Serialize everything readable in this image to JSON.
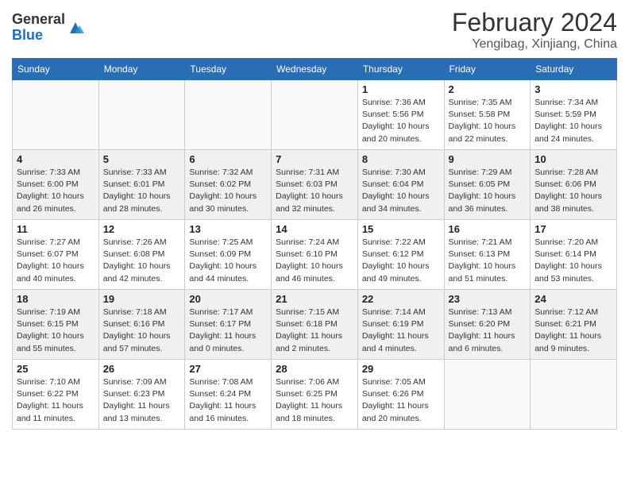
{
  "header": {
    "logo_general": "General",
    "logo_blue": "Blue",
    "month_year": "February 2024",
    "location": "Yengibag, Xinjiang, China"
  },
  "days_of_week": [
    "Sunday",
    "Monday",
    "Tuesday",
    "Wednesday",
    "Thursday",
    "Friday",
    "Saturday"
  ],
  "weeks": [
    [
      {
        "day": "",
        "info": ""
      },
      {
        "day": "",
        "info": ""
      },
      {
        "day": "",
        "info": ""
      },
      {
        "day": "",
        "info": ""
      },
      {
        "day": "1",
        "info": "Sunrise: 7:36 AM\nSunset: 5:56 PM\nDaylight: 10 hours and 20 minutes."
      },
      {
        "day": "2",
        "info": "Sunrise: 7:35 AM\nSunset: 5:58 PM\nDaylight: 10 hours and 22 minutes."
      },
      {
        "day": "3",
        "info": "Sunrise: 7:34 AM\nSunset: 5:59 PM\nDaylight: 10 hours and 24 minutes."
      }
    ],
    [
      {
        "day": "4",
        "info": "Sunrise: 7:33 AM\nSunset: 6:00 PM\nDaylight: 10 hours and 26 minutes."
      },
      {
        "day": "5",
        "info": "Sunrise: 7:33 AM\nSunset: 6:01 PM\nDaylight: 10 hours and 28 minutes."
      },
      {
        "day": "6",
        "info": "Sunrise: 7:32 AM\nSunset: 6:02 PM\nDaylight: 10 hours and 30 minutes."
      },
      {
        "day": "7",
        "info": "Sunrise: 7:31 AM\nSunset: 6:03 PM\nDaylight: 10 hours and 32 minutes."
      },
      {
        "day": "8",
        "info": "Sunrise: 7:30 AM\nSunset: 6:04 PM\nDaylight: 10 hours and 34 minutes."
      },
      {
        "day": "9",
        "info": "Sunrise: 7:29 AM\nSunset: 6:05 PM\nDaylight: 10 hours and 36 minutes."
      },
      {
        "day": "10",
        "info": "Sunrise: 7:28 AM\nSunset: 6:06 PM\nDaylight: 10 hours and 38 minutes."
      }
    ],
    [
      {
        "day": "11",
        "info": "Sunrise: 7:27 AM\nSunset: 6:07 PM\nDaylight: 10 hours and 40 minutes."
      },
      {
        "day": "12",
        "info": "Sunrise: 7:26 AM\nSunset: 6:08 PM\nDaylight: 10 hours and 42 minutes."
      },
      {
        "day": "13",
        "info": "Sunrise: 7:25 AM\nSunset: 6:09 PM\nDaylight: 10 hours and 44 minutes."
      },
      {
        "day": "14",
        "info": "Sunrise: 7:24 AM\nSunset: 6:10 PM\nDaylight: 10 hours and 46 minutes."
      },
      {
        "day": "15",
        "info": "Sunrise: 7:22 AM\nSunset: 6:12 PM\nDaylight: 10 hours and 49 minutes."
      },
      {
        "day": "16",
        "info": "Sunrise: 7:21 AM\nSunset: 6:13 PM\nDaylight: 10 hours and 51 minutes."
      },
      {
        "day": "17",
        "info": "Sunrise: 7:20 AM\nSunset: 6:14 PM\nDaylight: 10 hours and 53 minutes."
      }
    ],
    [
      {
        "day": "18",
        "info": "Sunrise: 7:19 AM\nSunset: 6:15 PM\nDaylight: 10 hours and 55 minutes."
      },
      {
        "day": "19",
        "info": "Sunrise: 7:18 AM\nSunset: 6:16 PM\nDaylight: 10 hours and 57 minutes."
      },
      {
        "day": "20",
        "info": "Sunrise: 7:17 AM\nSunset: 6:17 PM\nDaylight: 11 hours and 0 minutes."
      },
      {
        "day": "21",
        "info": "Sunrise: 7:15 AM\nSunset: 6:18 PM\nDaylight: 11 hours and 2 minutes."
      },
      {
        "day": "22",
        "info": "Sunrise: 7:14 AM\nSunset: 6:19 PM\nDaylight: 11 hours and 4 minutes."
      },
      {
        "day": "23",
        "info": "Sunrise: 7:13 AM\nSunset: 6:20 PM\nDaylight: 11 hours and 6 minutes."
      },
      {
        "day": "24",
        "info": "Sunrise: 7:12 AM\nSunset: 6:21 PM\nDaylight: 11 hours and 9 minutes."
      }
    ],
    [
      {
        "day": "25",
        "info": "Sunrise: 7:10 AM\nSunset: 6:22 PM\nDaylight: 11 hours and 11 minutes."
      },
      {
        "day": "26",
        "info": "Sunrise: 7:09 AM\nSunset: 6:23 PM\nDaylight: 11 hours and 13 minutes."
      },
      {
        "day": "27",
        "info": "Sunrise: 7:08 AM\nSunset: 6:24 PM\nDaylight: 11 hours and 16 minutes."
      },
      {
        "day": "28",
        "info": "Sunrise: 7:06 AM\nSunset: 6:25 PM\nDaylight: 11 hours and 18 minutes."
      },
      {
        "day": "29",
        "info": "Sunrise: 7:05 AM\nSunset: 6:26 PM\nDaylight: 11 hours and 20 minutes."
      },
      {
        "day": "",
        "info": ""
      },
      {
        "day": "",
        "info": ""
      }
    ]
  ]
}
